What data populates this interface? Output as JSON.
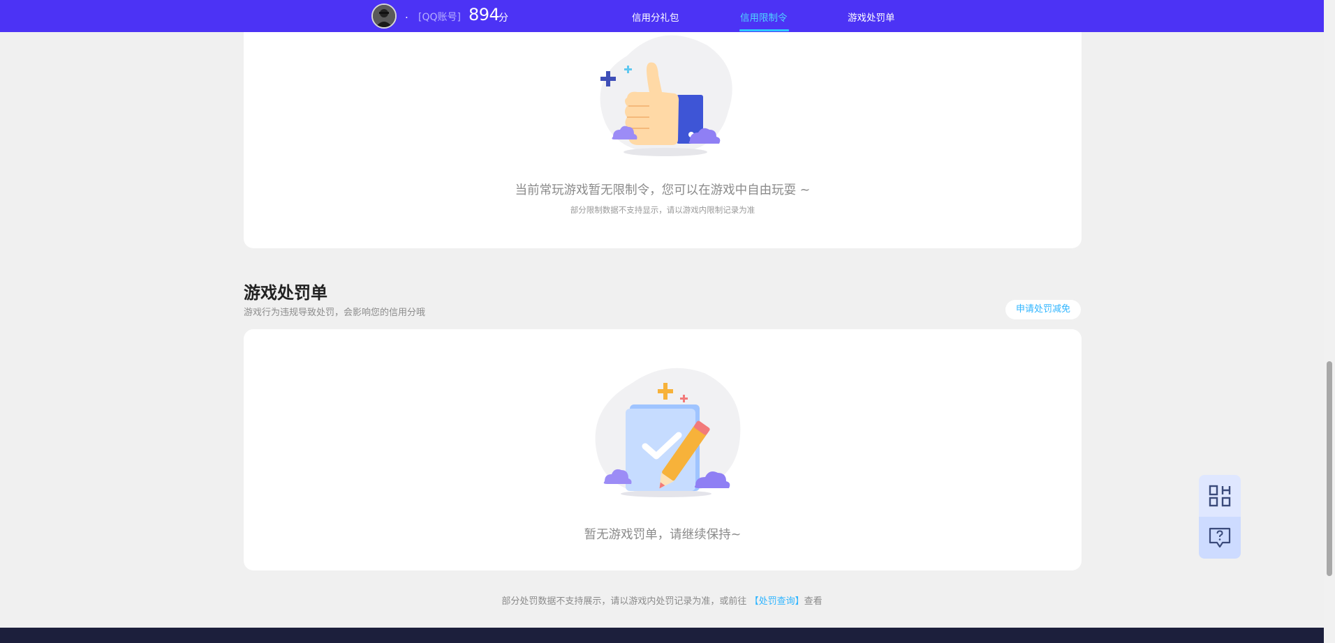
{
  "header": {
    "nickname": ".",
    "account_tag": "[QQ账号]",
    "score": "894",
    "score_unit": "分",
    "tabs": [
      {
        "label": "信用分礼包",
        "active": false
      },
      {
        "label": "信用限制令",
        "active": true
      },
      {
        "label": "游戏处罚单",
        "active": false
      }
    ]
  },
  "restrict": {
    "empty_text": "当前常玩游戏暂无限制令，您可以在游戏中自由玩耍 ~",
    "note": "部分限制数据不支持显示，请以游戏内限制记录为准"
  },
  "penalty": {
    "title": "游戏处罚单",
    "description": "游戏行为违规导致处罚，会影响您的信用分哦",
    "appeal_label": "申请处罚减免",
    "empty_text": "暂无游戏罚单，请继续保持~"
  },
  "footer": {
    "note_before": "部分处罚数据不支持展示，请以游戏内处罚记录为准，或前往",
    "link": "【处罚查询】",
    "note_after": "查看"
  },
  "side": {
    "qr_icon": "qr-code-icon",
    "help_icon": "help-chat-icon"
  },
  "colors": {
    "brand": "#4c33f5",
    "active_tab": "#4fd6ff",
    "link": "#2fb5ff"
  }
}
